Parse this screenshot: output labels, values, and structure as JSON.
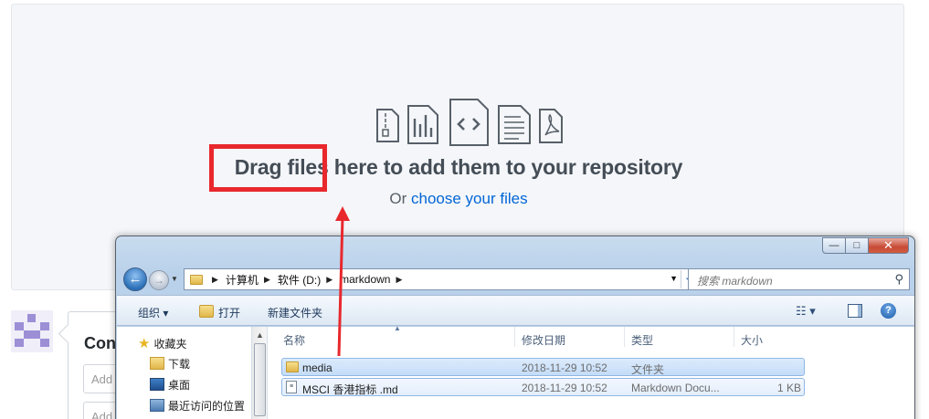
{
  "dropzone": {
    "heading": "Drag files here to add them to your repository",
    "sub_prefix": "Or",
    "sub_link": "choose your files"
  },
  "commit": {
    "title": "Con",
    "input1_placeholder": "Add",
    "input2_placeholder": "Add"
  },
  "explorer": {
    "window_buttons": {
      "minimize": "—",
      "maximize": "□",
      "close": "✕"
    },
    "nav": {
      "back": "←",
      "forward": "→"
    },
    "breadcrumbs": [
      "计算机",
      "软件 (D:)",
      "markdown"
    ],
    "search_placeholder": "搜索 markdown",
    "toolbar": {
      "organize": "组织 ▾",
      "open": "打开",
      "new_folder": "新建文件夹"
    },
    "nav_pane": [
      {
        "label": "收藏夹",
        "icon": "star-icon"
      },
      {
        "label": "下载",
        "icon": "download-folder-icon"
      },
      {
        "label": "桌面",
        "icon": "desktop-icon"
      },
      {
        "label": "最近访问的位置",
        "icon": "recent-places-icon"
      }
    ],
    "columns": [
      "名称",
      "修改日期",
      "类型",
      "大小"
    ],
    "files": [
      {
        "name": "media",
        "date": "2018-11-29 10:52",
        "type": "文件夹",
        "size": "",
        "icon": "folder-icon"
      },
      {
        "name": "MSCI 香港指标 .md",
        "date": "2018-11-29 10:52",
        "type": "Markdown Docu...",
        "size": "1 KB",
        "icon": "markdown-file-icon"
      }
    ]
  },
  "colors": {
    "highlight": "#e8282d",
    "link": "#0366d6"
  }
}
